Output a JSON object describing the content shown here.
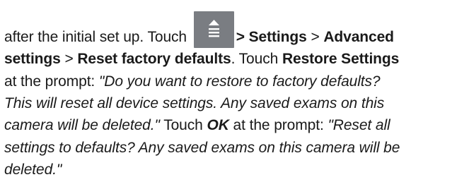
{
  "paragraph": {
    "line1": {
      "text_before_icon": "after the initial set up. Touch ",
      "settings_path_part1": "> Settings",
      "separator1": " > ",
      "settings_path_part2": "Advanced"
    },
    "line2": {
      "settings_path_part2_cont": "settings",
      "separator2": " > ",
      "settings_path_part3": "Reset factory defaults",
      "text_touch": ". Touch ",
      "restore_button": "Restore Settings"
    },
    "line3": {
      "text_prompt": "at the prompt: ",
      "quote1_part1": "\"Do you want to restore to factory defaults?"
    },
    "line4": {
      "quote1_part2": "This will reset all device settings. Any saved exams on this"
    },
    "line5": {
      "quote1_part3": "camera will be deleted.\"",
      "text_touch2": " Touch ",
      "ok_button": "OK",
      "text_prompt2": " at the prompt: ",
      "quote2_part1": "\"Reset all"
    },
    "line6": {
      "quote2_part2": "settings to defaults? Any saved exams on this camera will be"
    },
    "line7": {
      "quote2_part3": "deleted.\""
    },
    "menu_icon": "eject-menu-icon",
    "menu_icon_color": "#7a7d82"
  }
}
